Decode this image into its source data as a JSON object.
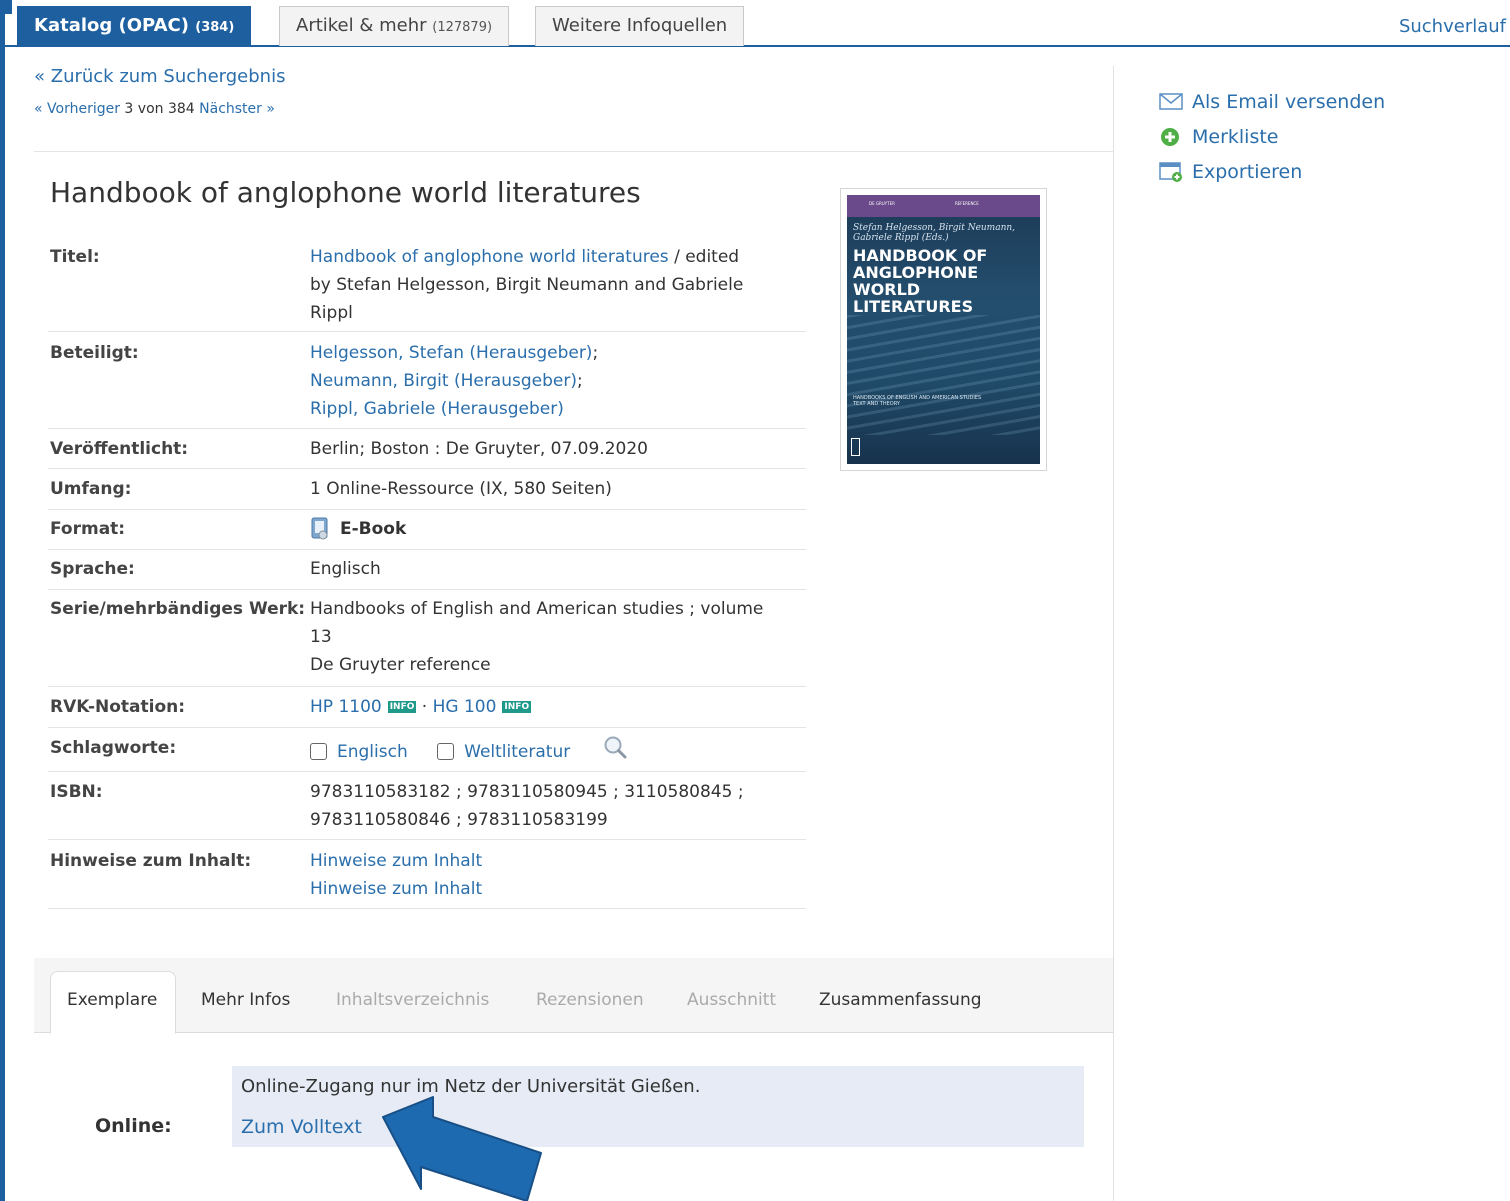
{
  "top_tabs": [
    {
      "label": "Katalog (OPAC)",
      "count": "(384)"
    },
    {
      "label": "Artikel & mehr",
      "count": "(127879)"
    },
    {
      "label": "Weitere Infoquellen",
      "count": ""
    }
  ],
  "search_history": "Suchverlauf",
  "back_link": "« Zurück zum Suchergebnis",
  "pager": {
    "prev": "« Vorheriger",
    "position": "3 von 384",
    "next": "Nächster »"
  },
  "title": "Handbook of anglophone world literatures",
  "details": {
    "titel_label": "Titel:",
    "titel_link": "Handbook of anglophone world literatures",
    "titel_rest_1": " / edited",
    "titel_rest_2": "by Stefan Helgesson, Birgit Neumann and Gabriele",
    "titel_rest_3": "Rippl",
    "beteiligt_label": "Beteiligt:",
    "beteiligt": [
      {
        "name": "Helgesson, Stefan (Herausgeber)",
        "sep": ";"
      },
      {
        "name": "Neumann, Birgit (Herausgeber)",
        "sep": ";"
      },
      {
        "name": "Rippl, Gabriele (Herausgeber)",
        "sep": ""
      }
    ],
    "veroeffentlicht_label": "Veröffentlicht:",
    "veroeffentlicht": "Berlin; Boston : De Gruyter, 07.09.2020",
    "umfang_label": "Umfang:",
    "umfang": "1 Online-Ressource (IX, 580 Seiten)",
    "format_label": "Format:",
    "format": "E-Book",
    "sprache_label": "Sprache:",
    "sprache": "Englisch",
    "serie_label_1": "Serie/mehrbändiges",
    "serie_label_2": "Werk:",
    "serie_1": "Handbooks of English and American studies ; volume",
    "serie_2": "13",
    "serie_3": "De Gruyter reference",
    "rvk_label": "RVK-Notation:",
    "rvk_1": "HP 1100",
    "rvk_sep": "·",
    "rvk_2": "HG 100",
    "info_badge": "INFO",
    "schlagworte_label": "Schlagworte:",
    "schlagwort_1": "Englisch",
    "schlagwort_2": "Weltliteratur",
    "isbn_label": "ISBN:",
    "isbn_1": "9783110583182 ; 9783110580945 ; 3110580845 ;",
    "isbn_2": "9783110580846 ; 9783110583199",
    "hinweise_label": "Hinweise zum Inhalt:",
    "hinweise_1": "Hinweise zum Inhalt",
    "hinweise_2": "Hinweise zum Inhalt"
  },
  "cover": {
    "band_left": "DE GRUYTER",
    "band_right": "REFERENCE",
    "authors_1": "Stefan Helgesson, Birgit Neumann,",
    "authors_2": "Gabriele Rippl (Eds.)",
    "title_1": "HANDBOOK OF",
    "title_2": "ANGLOPHONE",
    "title_3": "WORLD",
    "title_4": "LITERATURES",
    "series_1": "HANDBOOKS OF ENGLISH AND AMERICAN STUDIES",
    "series_2": "TEXT AND THEORY"
  },
  "sidebar": [
    {
      "label": "Als Email versenden",
      "icon": "email-icon"
    },
    {
      "label": "Merkliste",
      "icon": "add-circle-icon"
    },
    {
      "label": "Exportieren",
      "icon": "export-icon"
    }
  ],
  "bottom_tabs": [
    "Exemplare",
    "Mehr Infos",
    "Inhaltsverzeichnis",
    "Rezensionen",
    "Ausschnitt",
    "Zusammenfassung"
  ],
  "holdings": {
    "label": "Online:",
    "note": "Online-Zugang nur im Netz der Universität Gießen.",
    "link": "Zum Volltext"
  },
  "colors": {
    "accent": "#1e5fa0",
    "link": "#2a6eab",
    "holdings_bg": "#e6ebf5",
    "arrow": "#1e6ab0"
  }
}
